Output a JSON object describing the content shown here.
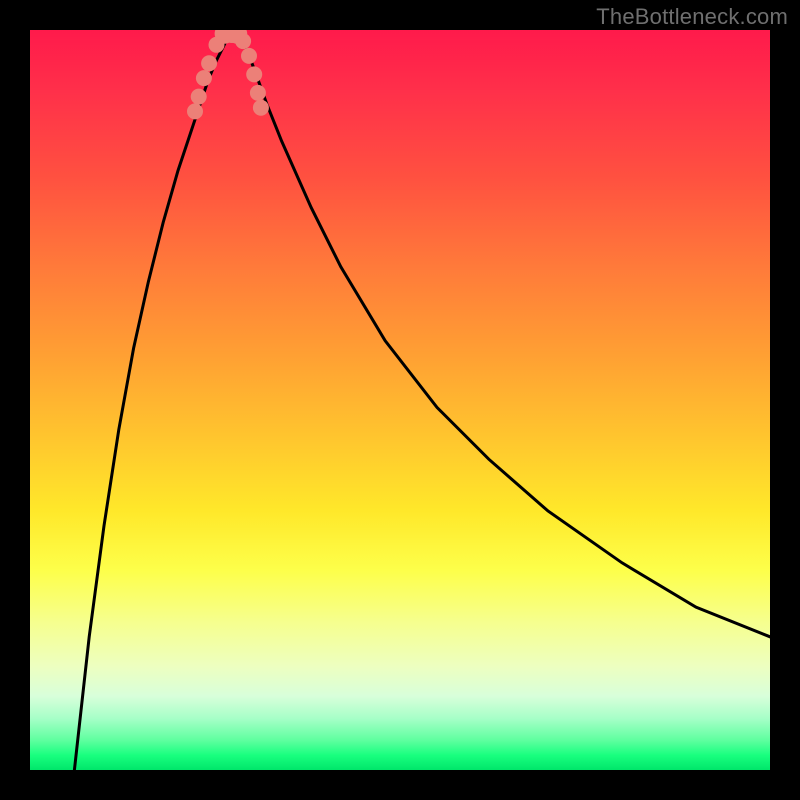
{
  "watermark": "TheBottleneck.com",
  "colors": {
    "frame": "#000000",
    "curve": "#000000",
    "bead": "#ec8078",
    "gradient_top": "#ff1a4b",
    "gradient_bottom": "#00e66a"
  },
  "chart_data": {
    "type": "line",
    "title": "",
    "xlabel": "",
    "ylabel": "",
    "xlim": [
      0,
      100
    ],
    "ylim": [
      0,
      100
    ],
    "notes": "Bottleneck-style curve; y≈100 at minimum, drops toward 0 away from minimum. Minimum near x≈27. Values estimated from pixel positions.",
    "series": [
      {
        "name": "curve",
        "x": [
          6,
          8,
          10,
          12,
          14,
          16,
          18,
          20,
          22,
          24,
          25,
          26,
          27,
          28,
          29,
          30,
          32,
          34,
          38,
          42,
          48,
          55,
          62,
          70,
          80,
          90,
          100
        ],
        "y": [
          0,
          18,
          33,
          46,
          57,
          66,
          74,
          81,
          87,
          93,
          95.5,
          97.5,
          99.5,
          99.6,
          98.0,
          95.5,
          90,
          85,
          76,
          68,
          58,
          49,
          42,
          35,
          28,
          22,
          18
        ]
      }
    ],
    "markers": {
      "name": "hotspot-beads",
      "x": [
        22.3,
        22.8,
        23.5,
        24.2,
        25.2,
        26.3,
        27.3,
        28.0,
        28.8,
        29.6,
        30.3,
        30.8,
        31.2
      ],
      "y": [
        89,
        91,
        93.5,
        95.5,
        98,
        99.5,
        99.6,
        99.5,
        98.5,
        96.5,
        94,
        91.5,
        89.5
      ]
    }
  }
}
